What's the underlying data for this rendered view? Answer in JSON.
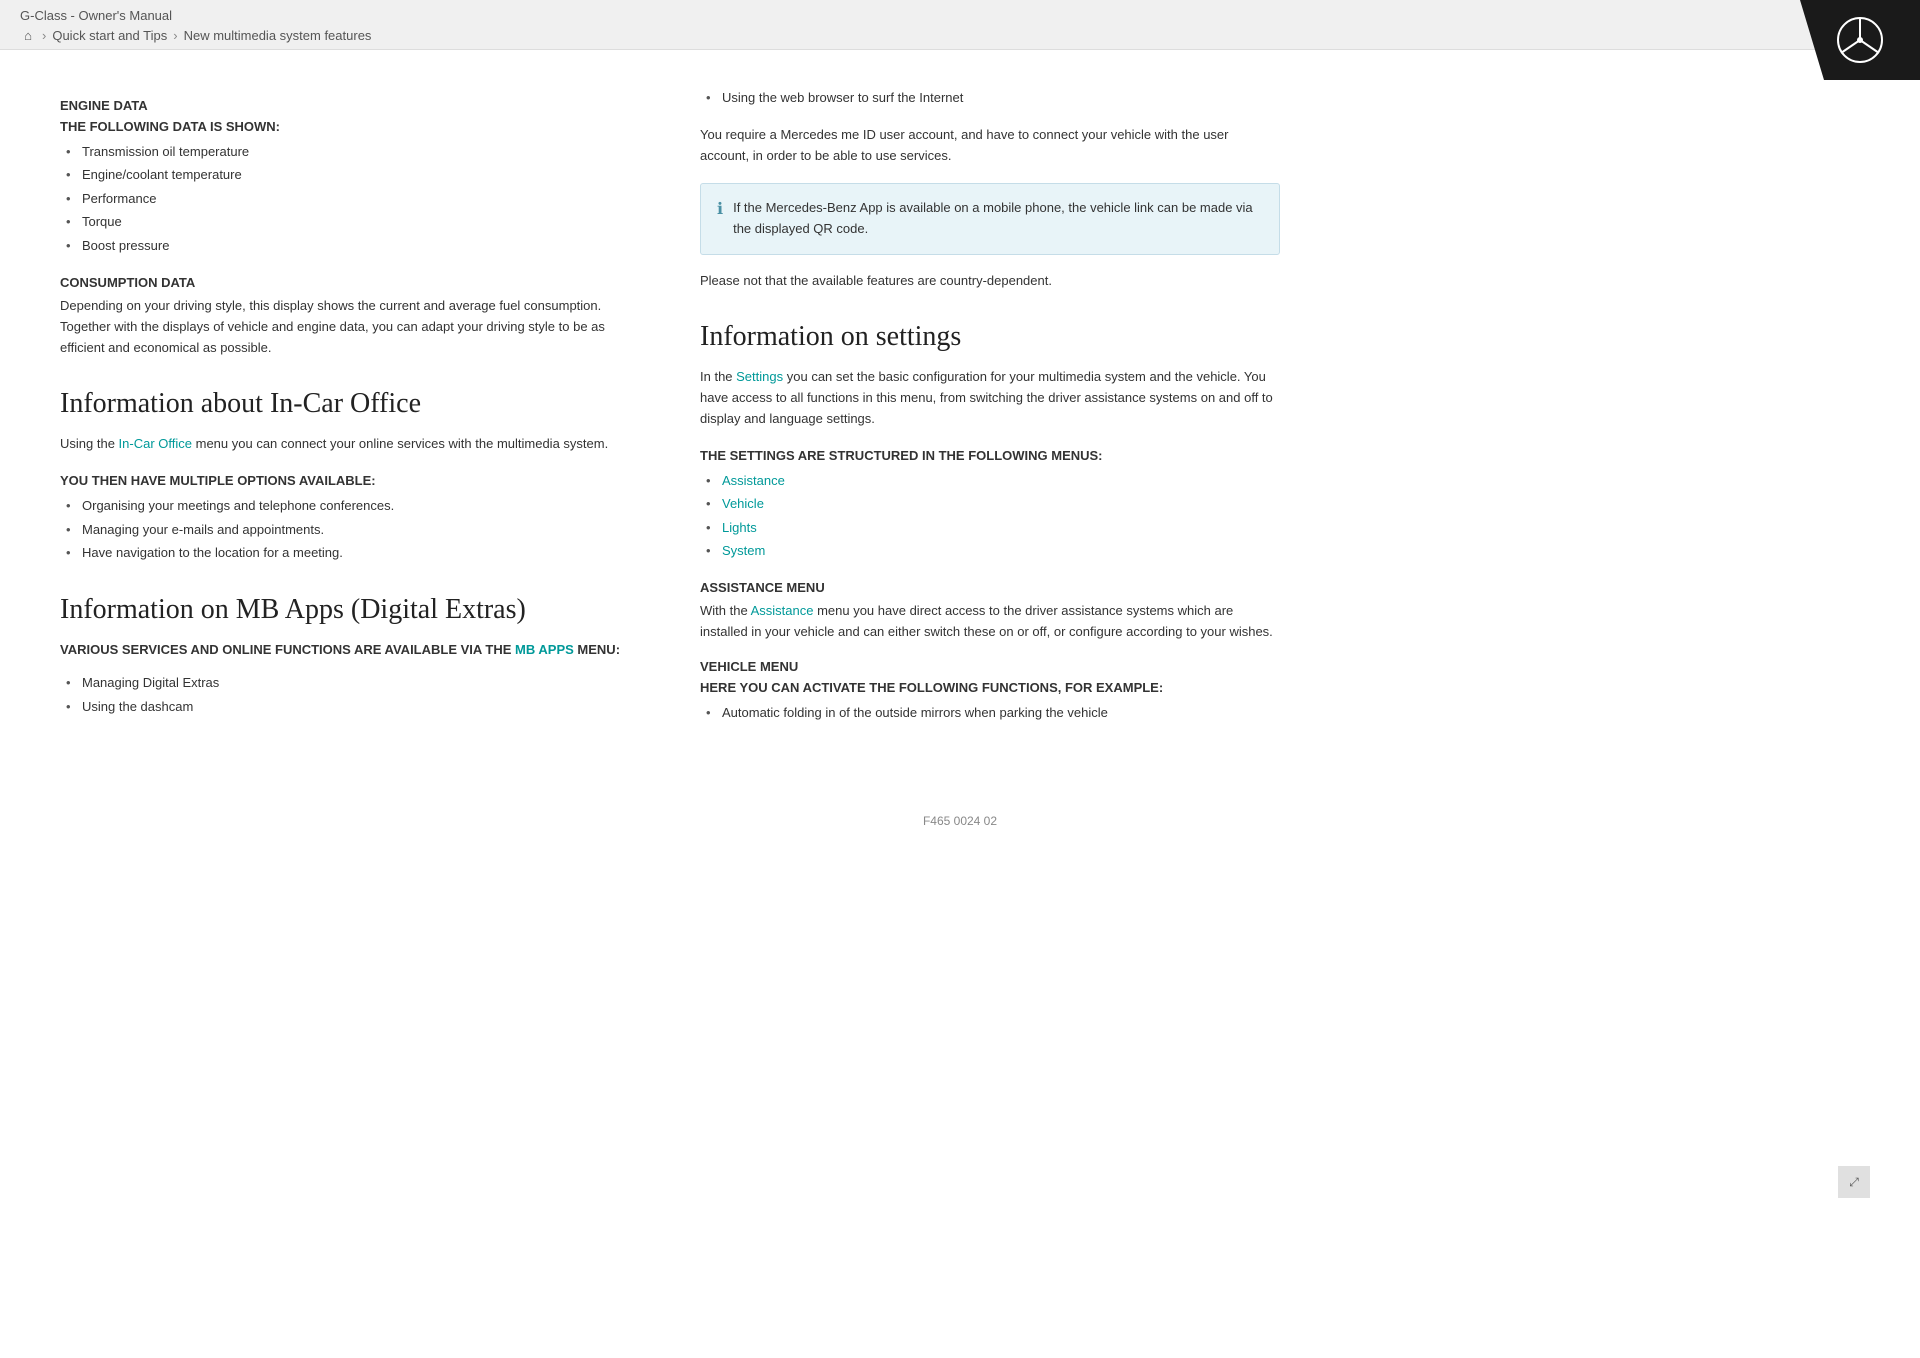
{
  "header": {
    "title": "G-Class - Owner's Manual",
    "breadcrumb": {
      "home_label": "home",
      "step1": "Quick start and Tips",
      "step2": "New multimedia system features"
    }
  },
  "left_column": {
    "engine_data": {
      "section_label": "ENGINE DATA",
      "subsection_label": "THE FOLLOWING DATA IS SHOWN:",
      "items": [
        "Transmission oil temperature",
        "Engine/coolant temperature",
        "Performance",
        "Torque",
        "Boost pressure"
      ]
    },
    "consumption_data": {
      "section_label": "CONSUMPTION DATA",
      "body": "Depending on your driving style, this display shows the current and average fuel consumption. Together with the displays of vehicle and engine data, you can adapt your driving style to be as efficient and economical as possible."
    },
    "incar_office": {
      "heading": "Information about In-Car Office",
      "intro_before": "Using the ",
      "intro_link": "In-Car Office",
      "intro_after": " menu you can connect your online services with the multimedia system.",
      "options_label": "YOU THEN HAVE MULTIPLE OPTIONS AVAILABLE:",
      "options": [
        "Organising your meetings and telephone conferences.",
        "Managing your e-mails and appointments.",
        "Have navigation to the location for a meeting."
      ]
    },
    "mb_apps": {
      "heading": "Information on MB Apps (Digital Extras)",
      "services_label_part1": "VARIOUS SERVICES AND ONLINE FUNCTIONS ARE AVAILABLE VIA THE",
      "services_link": "MB APPS",
      "services_label_part2": "MENU:",
      "items": [
        "Managing Digital Extras",
        "Using the dashcam"
      ]
    }
  },
  "right_column": {
    "bullet_intro": "Using the web browser to surf the Internet",
    "para1": "You require a Mercedes me ID user account, and have to connect your vehicle with the user account, in order to be able to use services.",
    "info_box": "If the Mercedes-Benz App is available on a mobile phone, the vehicle link can be made via the displayed QR code.",
    "para2": "Please not that the available features are country-dependent.",
    "settings": {
      "heading": "Information on settings",
      "intro": "In the Settings you can set the basic configuration for your multimedia system and the vehicle. You have access to all functions in this menu, from switching the driver assistance systems on and off to display and language settings.",
      "menus_label": "THE SETTINGS ARE STRUCTURED IN THE FOLLOWING MENUS:",
      "menu_items": [
        "Assistance",
        "Vehicle",
        "Lights",
        "System"
      ],
      "assistance_menu": {
        "label": "ASSISTANCE MENU",
        "body_before": "With the ",
        "body_link": "Assistance",
        "body_after": " menu you have direct access to the driver assistance systems which are installed in your vehicle and can either switch these on or off, or configure according to your wishes."
      },
      "vehicle_menu": {
        "label": "VEHICLE MENU",
        "sub_label": "HERE YOU CAN ACTIVATE THE FOLLOWING FUNCTIONS, FOR EXAMPLE:",
        "items": [
          "Automatic folding in of the outside mirrors when parking the vehicle"
        ]
      }
    }
  },
  "footer": {
    "code": "F465 0024 02"
  },
  "icons": {
    "info_icon": "ℹ",
    "home_icon": "⌂",
    "chevron_icon": "›",
    "scroll_up": "∧",
    "scroll_icon": "⤢"
  }
}
